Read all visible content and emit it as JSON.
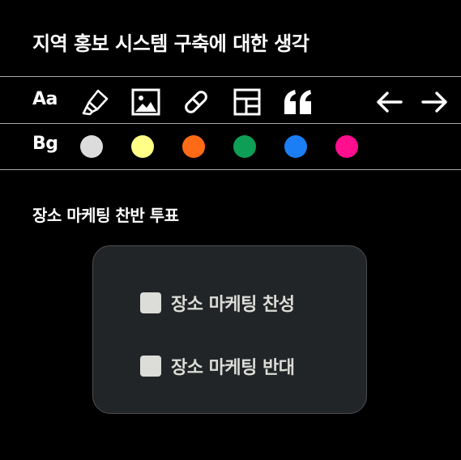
{
  "header": {
    "title": "지역 홍보 시스템 구축에 대한 생각"
  },
  "toolbar": {
    "text_label": "Aa",
    "tools": [
      {
        "name": "highlighter-icon"
      },
      {
        "name": "image-icon"
      },
      {
        "name": "link-icon"
      },
      {
        "name": "layout-icon"
      },
      {
        "name": "quote-icon",
        "glyph": "“"
      }
    ],
    "nav": [
      {
        "name": "arrow-left-icon",
        "glyph": "←"
      },
      {
        "name": "arrow-right-icon",
        "glyph": "→"
      }
    ]
  },
  "background": {
    "label": "Bg",
    "colors": [
      "#dcdcdc",
      "#fffe86",
      "#ff6a16",
      "#0e9e56",
      "#1b7ef5",
      "#ff0e8d"
    ]
  },
  "poll": {
    "title": "장소 마케팅 찬반 투표",
    "options": [
      {
        "label": "장소 마케팅 찬성",
        "checked": false
      },
      {
        "label": "장소 마케팅 반대",
        "checked": false
      }
    ]
  }
}
